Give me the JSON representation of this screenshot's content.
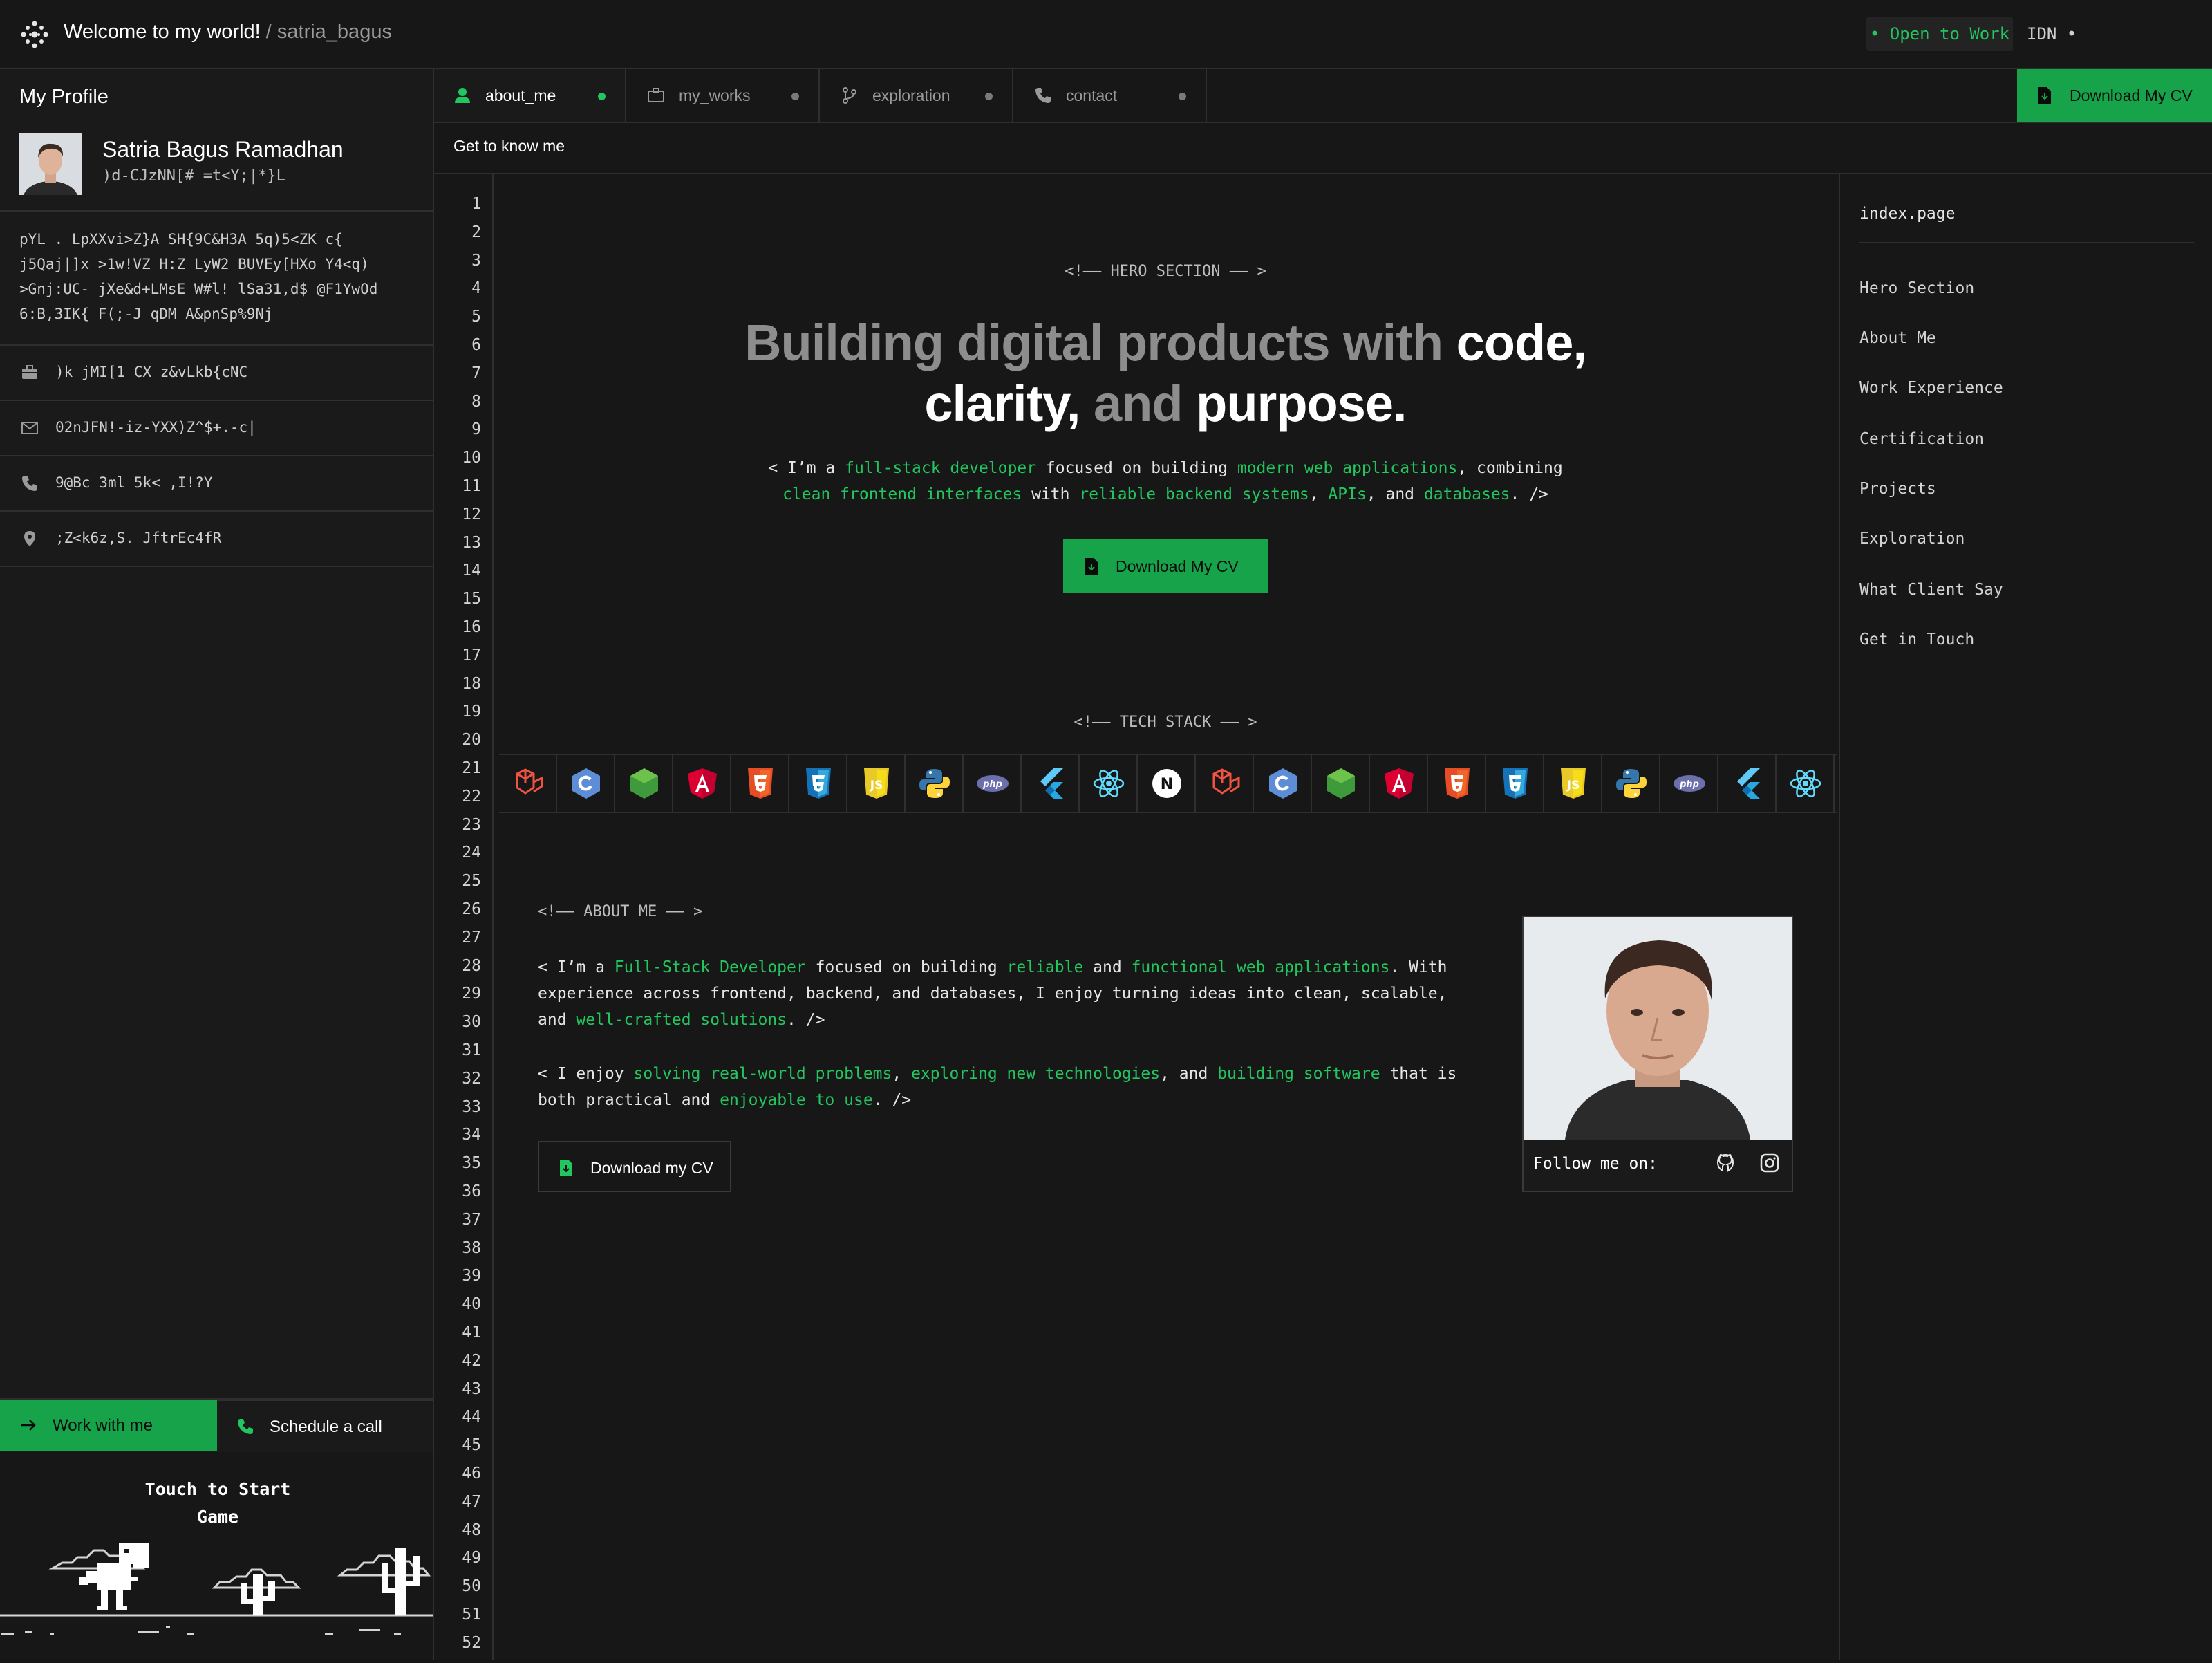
{
  "header": {
    "title": "Welcome to my world!",
    "separator": " / ",
    "username": "satria_bagus",
    "status_badge": "• Open to Work",
    "language": "IDN •"
  },
  "sidebar": {
    "heading": "My Profile",
    "name": "Satria Bagus Ramadhan",
    "handle": ")d-CJzNN[# =t<Y;|*}L",
    "bio": "pYL . LpXXvi>Z}A SH{9C&H3A 5q)5<ZK c{ j5Qaj|]x >1w!VZ H:Z LyW2 BUVEy[HXo Y4<q) >Gnj:UC- jXe&d+LMsE W#l! lSa31,d$ @F1YwOd 6:B,3IK{ F(;-J qDM A&pnSp%9Nj",
    "info": [
      {
        "icon": "briefcase-icon",
        "text": ")k jMI[1 CX z&vLkb{cNC"
      },
      {
        "icon": "mail-icon",
        "text": "02nJFN!-iz-YXX)Z^$+.-c|"
      },
      {
        "icon": "phone-icon",
        "text": "9@Bc 3ml 5k< ,I!?Y"
      },
      {
        "icon": "location-icon",
        "text": ";Z<k6z,S. JftrEc4fR"
      }
    ],
    "work_button": "Work with me",
    "call_button": "Schedule a call",
    "game_text": "Touch to Start Game"
  },
  "tabs": [
    {
      "label": "about_me",
      "icon": "user-icon",
      "active": true
    },
    {
      "label": "my_works",
      "icon": "briefcase-icon",
      "active": false
    },
    {
      "label": "exploration",
      "icon": "git-branch-icon",
      "active": false
    },
    {
      "label": "contact",
      "icon": "phone-icon",
      "active": false
    }
  ],
  "download_top": "Download My CV",
  "subheading": "Get to know me",
  "line_count": 52,
  "hero": {
    "comment": "<!—— HERO SECTION —— >",
    "title_1": "Building digital products with ",
    "title_2": "code,",
    "title_3": "clarity,",
    "title_4": " and ",
    "title_5": "purpose.",
    "desc": {
      "p1": "< I’m a ",
      "h1": "full-stack developer",
      "p2": " focused on building ",
      "h2": "modern web applications",
      "p3": ", combining ",
      "h3": "clean frontend interfaces",
      "p4": " with ",
      "h4": "reliable backend systems",
      "p5": ", ",
      "h5": "APIs",
      "p6": ", and ",
      "h6": "databases",
      "p7": ". />"
    },
    "button": "Download My CV"
  },
  "tech_stack": {
    "comment": "<!—— TECH STACK —— >",
    "icons": [
      "laravel-icon",
      "c-sharp-icon",
      "nodejs-icon",
      "angular-icon",
      "html5-icon",
      "css3-icon",
      "javascript-icon",
      "python-icon",
      "php-icon",
      "flutter-icon",
      "react-icon",
      "nextjs-icon",
      "laravel-icon",
      "c-sharp-icon",
      "nodejs-icon",
      "angular-icon",
      "html5-icon",
      "css3-icon",
      "javascript-icon",
      "python-icon",
      "php-icon",
      "flutter-icon",
      "react-icon"
    ]
  },
  "about": {
    "comment": "<!—— ABOUT ME —— >",
    "para1": {
      "p1": "< I’m a ",
      "h1": "Full-Stack Developer",
      "p2": " focused on building ",
      "h2": "reliable",
      "p3": " and ",
      "h3": "functional web applications",
      "p4": ". With experience across frontend, backend, and databases, I enjoy turning ideas into clean, scalable, and ",
      "h4": "well-crafted solutions",
      "p5": ". />"
    },
    "para2": {
      "p1": "< I enjoy ",
      "h1": "solving real-world problems",
      "p2": ", ",
      "h2": "exploring new technologies",
      "p3": ", and ",
      "h3": "building software",
      "p4": " that is both practical and ",
      "h4": "enjoyable to use",
      "p5": ". />"
    },
    "button": "Download my CV",
    "follow": "Follow me on:"
  },
  "toc": {
    "head": "index.page",
    "items": [
      "Hero Section",
      "About Me",
      "Work Experience",
      "Certification",
      "Projects",
      "Exploration",
      "What Client Say",
      "Get in Touch"
    ]
  },
  "colors": {
    "accent": "#22c55e",
    "accent_dark": "#16a34a",
    "background": "#171717"
  }
}
